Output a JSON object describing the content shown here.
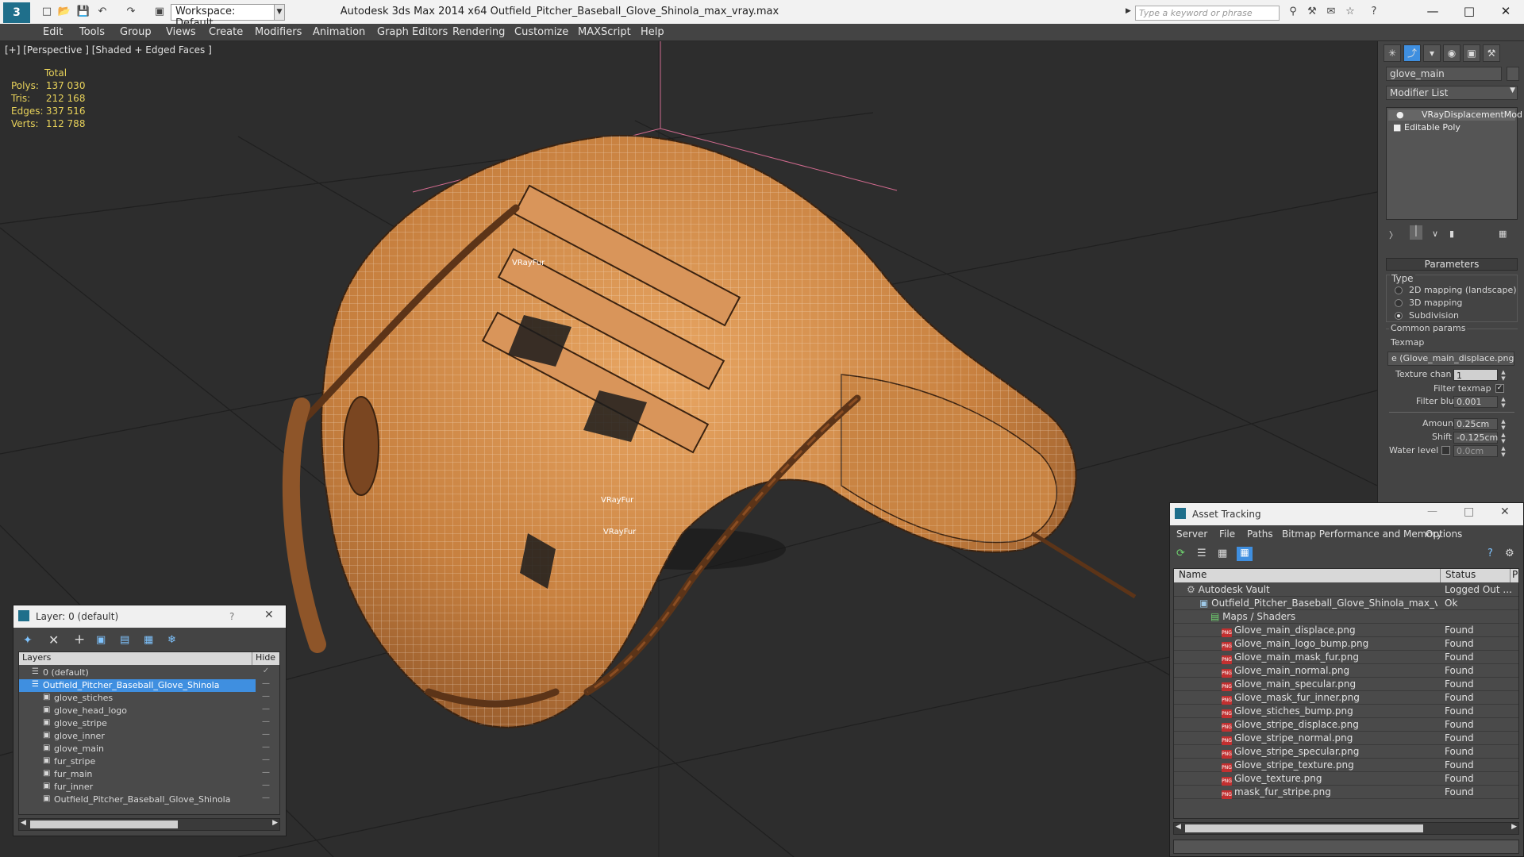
{
  "app": {
    "title": "Autodesk 3ds Max  2014 x64     Outfield_Pitcher_Baseball_Glove_Shinola_max_vray.max",
    "workspace": "Workspace: Default",
    "search_placeholder": "Type a keyword or phrase"
  },
  "menu": [
    "Edit",
    "Tools",
    "Group",
    "Views",
    "Create",
    "Modifiers",
    "Animation",
    "Graph Editors",
    "Rendering",
    "Customize",
    "MAXScript",
    "Help"
  ],
  "viewport": {
    "label": "[+] [Perspective ] [Shaded + Edged Faces ]",
    "stats": {
      "header": "Total",
      "rows": [
        {
          "label": "Polys:",
          "value": "137 030"
        },
        {
          "label": "Tris:",
          "value": "212 168"
        },
        {
          "label": "Edges:",
          "value": "337 516"
        },
        {
          "label": "Verts:",
          "value": "112 788"
        }
      ]
    },
    "fur_labels": [
      "VRayFur",
      "VRayFur",
      "VRayFur"
    ]
  },
  "command_panel": {
    "object_name": "glove_main",
    "modifier_list": "Modifier List",
    "stack": [
      "VRayDisplacementMod",
      "Editable Poly"
    ],
    "parameters_title": "Parameters",
    "type_label": "Type",
    "type_options": [
      "2D mapping (landscape)",
      "3D mapping",
      "Subdivision"
    ],
    "common_params": "Common params",
    "texmap_label": "Texmap",
    "texmap_value": "e (Glove_main_displace.png)",
    "texture_chan_label": "Texture chan",
    "texture_chan_value": "1",
    "filter_texmap": "Filter texmap",
    "filter_blur_label": "Filter blur",
    "filter_blur_value": "0.001",
    "amount_label": "Amount",
    "amount_value": "0.25cm",
    "shift_label": "Shift",
    "shift_value": "-0.125cm",
    "water_level_label": "Water level",
    "water_level_value": "0.0cm"
  },
  "layer_window": {
    "title": "Layer: 0 (default)",
    "help": "?",
    "col_layers": "Layers",
    "col_hide": "Hide",
    "rows": [
      {
        "name": "0 (default)",
        "indent": 1,
        "checked": true
      },
      {
        "name": "Outfield_Pitcher_Baseball_Glove_Shinola",
        "indent": 1,
        "selected": true
      },
      {
        "name": "glove_stiches",
        "indent": 2
      },
      {
        "name": "glove_head_logo",
        "indent": 2
      },
      {
        "name": "glove_stripe",
        "indent": 2
      },
      {
        "name": "glove_inner",
        "indent": 2
      },
      {
        "name": "glove_main",
        "indent": 2
      },
      {
        "name": "fur_stripe",
        "indent": 2
      },
      {
        "name": "fur_main",
        "indent": 2
      },
      {
        "name": "fur_inner",
        "indent": 2
      },
      {
        "name": "Outfield_Pitcher_Baseball_Glove_Shinola",
        "indent": 2
      }
    ]
  },
  "asset_window": {
    "title": "Asset Tracking",
    "menu": [
      "Server",
      "File",
      "Paths",
      "Bitmap Performance and Memory",
      "Options"
    ],
    "col_name": "Name",
    "col_status": "Status",
    "col_extra": "Pr",
    "rows": [
      {
        "name": "Autodesk Vault",
        "status": "Logged Out ...",
        "level": 0,
        "kind": "vault"
      },
      {
        "name": "Outfield_Pitcher_Baseball_Glove_Shinola_max_vray...",
        "status": "Ok",
        "level": 1,
        "kind": "file"
      },
      {
        "name": "Maps / Shaders",
        "status": "",
        "level": 2,
        "kind": "folder"
      },
      {
        "name": "Glove_main_displace.png",
        "status": "Found",
        "level": 3,
        "kind": "png"
      },
      {
        "name": "Glove_main_logo_bump.png",
        "status": "Found",
        "level": 3,
        "kind": "png"
      },
      {
        "name": "Glove_main_mask_fur.png",
        "status": "Found",
        "level": 3,
        "kind": "png"
      },
      {
        "name": "Glove_main_normal.png",
        "status": "Found",
        "level": 3,
        "kind": "png"
      },
      {
        "name": "Glove_main_specular.png",
        "status": "Found",
        "level": 3,
        "kind": "png"
      },
      {
        "name": "Glove_mask_fur_inner.png",
        "status": "Found",
        "level": 3,
        "kind": "png"
      },
      {
        "name": "Glove_stiches_bump.png",
        "status": "Found",
        "level": 3,
        "kind": "png"
      },
      {
        "name": "Glove_stripe_displace.png",
        "status": "Found",
        "level": 3,
        "kind": "png"
      },
      {
        "name": "Glove_stripe_normal.png",
        "status": "Found",
        "level": 3,
        "kind": "png"
      },
      {
        "name": "Glove_stripe_specular.png",
        "status": "Found",
        "level": 3,
        "kind": "png"
      },
      {
        "name": "Glove_stripe_texture.png",
        "status": "Found",
        "level": 3,
        "kind": "png"
      },
      {
        "name": "Glove_texture.png",
        "status": "Found",
        "level": 3,
        "kind": "png"
      },
      {
        "name": "mask_fur_stripe.png",
        "status": "Found",
        "level": 3,
        "kind": "png"
      }
    ]
  },
  "colors": {
    "accent_blue": "#3f8fe0",
    "stats_yellow": "#e8d25a",
    "glove_tan": "#d08a4c",
    "wire": "#ffffff"
  }
}
